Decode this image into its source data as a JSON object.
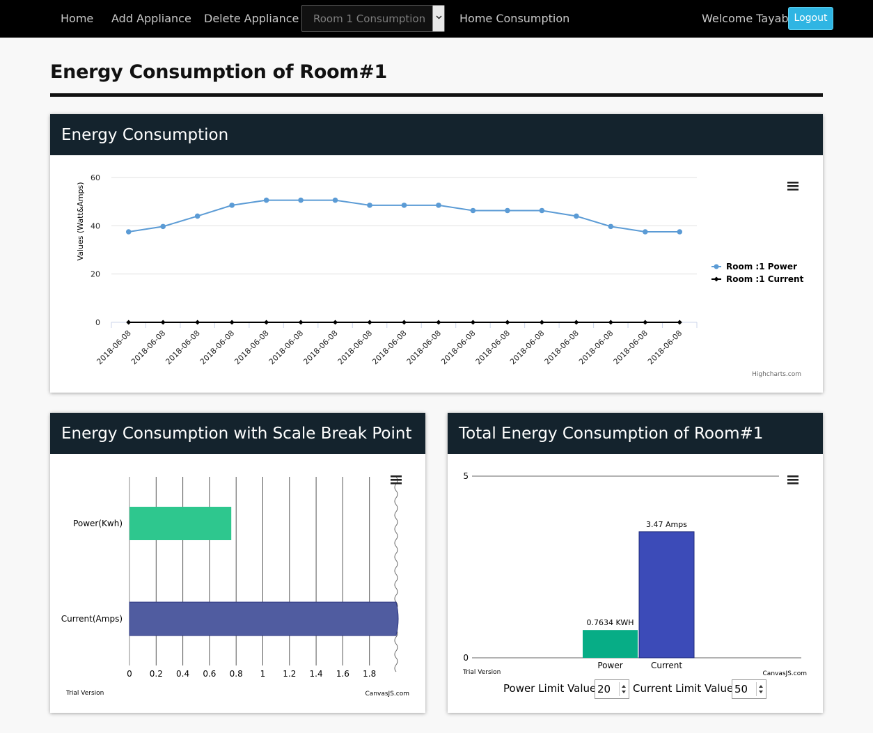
{
  "nav": {
    "home": "Home",
    "add": "Add Appliance",
    "delete": "Delete Appliance",
    "room_select": "Room 1 Consumption",
    "home_consumption": "Home Consumption",
    "welcome": "Welcome Tayab",
    "logout": "Logout"
  },
  "page_title": "Energy Consumption of Room#1",
  "panel1": {
    "title": "Energy Consumption",
    "credit": "Highcharts.com",
    "ylabel": "Values (Watt&Amps)"
  },
  "panel2": {
    "title": "Energy Consumption with Scale Break Point",
    "trial": "Trial Version",
    "credit": "CanvasJS.com"
  },
  "panel3": {
    "title": "Total Energy Consumption of Room#1",
    "trial": "Trial Version",
    "credit": "CanvasJS.com",
    "power_limit_label": "Power Limit Value:",
    "power_limit_value": "20",
    "current_limit_label": "Current Limit Value:",
    "current_limit_value": "50"
  },
  "colors": {
    "navbar": "#000000",
    "panel_header": "#14232d",
    "logout": "#2fb5e3",
    "power_line": "#5b9bd5",
    "current_line": "#000000",
    "bar_power_green": "#2ec78e",
    "bar_current_indigo": "#505ca0",
    "col_power": "#07ad86",
    "col_current": "#3c4bb8"
  },
  "chart_data": [
    {
      "type": "line",
      "x": [
        "2018-06-08",
        "2018-06-08",
        "2018-06-08",
        "2018-06-08",
        "2018-06-08",
        "2018-06-08",
        "2018-06-08",
        "2018-06-08",
        "2018-06-08",
        "2018-06-08",
        "2018-06-08",
        "2018-06-08",
        "2018-06-08",
        "2018-06-08",
        "2018-06-08",
        "2018-06-08",
        "2018-06-08"
      ],
      "series": [
        {
          "name": "Room :1 Power",
          "values": [
            37.5,
            39.7,
            44,
            48.5,
            50.6,
            50.6,
            50.6,
            48.5,
            48.5,
            48.5,
            46.3,
            46.3,
            46.3,
            44,
            39.7,
            37.5,
            37.5
          ]
        },
        {
          "name": "Room :1 Current",
          "values": [
            0,
            0,
            0,
            0,
            0,
            0,
            0,
            0,
            0,
            0,
            0,
            0,
            0,
            0,
            0,
            0,
            0
          ]
        }
      ],
      "yticks": [
        0,
        20,
        40,
        60
      ],
      "ylim": [
        0,
        60
      ],
      "ylabel": "Values (Watt&Amps)",
      "legend": "right",
      "grid": true
    },
    {
      "type": "bar",
      "orientation": "horizontal",
      "categories": [
        "Power(Kwh)",
        "Current(Amps)"
      ],
      "values": [
        0.7634,
        3.47
      ],
      "xticks": [
        "0",
        "0.2",
        "0.4",
        "0.6",
        "0.8",
        "1",
        "1.2",
        "1.4",
        "1.6",
        "1.8"
      ],
      "xlim": [
        0,
        1.9
      ],
      "scale_break": true,
      "grid": true
    },
    {
      "type": "bar",
      "categories": [
        "Power",
        "Current"
      ],
      "values": [
        0.7634,
        3.47
      ],
      "labels": [
        "0.7634 KWH",
        "3.47 Amps"
      ],
      "yticks": [
        0,
        5
      ],
      "ylim": [
        0,
        5
      ]
    }
  ]
}
